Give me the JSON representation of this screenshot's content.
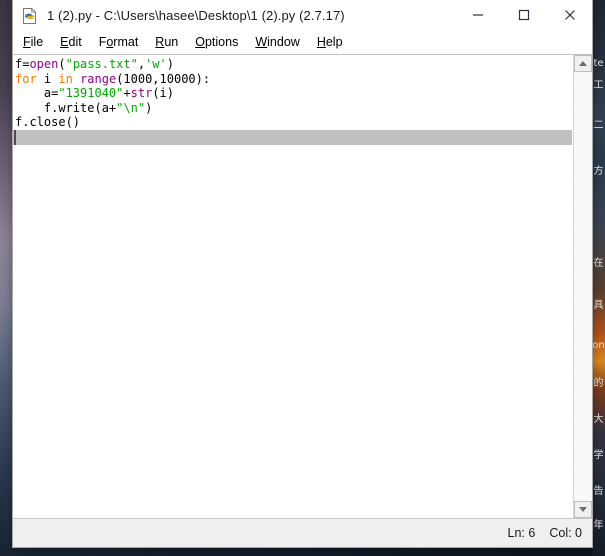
{
  "window": {
    "title": "1 (2).py - C:\\Users\\hasee\\Desktop\\1 (2).py (2.7.17)",
    "icon": "python-idle-file-icon",
    "controls": {
      "minimize": "—",
      "maximize": "□",
      "close": "✕"
    }
  },
  "menubar": {
    "items": [
      {
        "label": "File",
        "accel_index": 0
      },
      {
        "label": "Edit",
        "accel_index": 0
      },
      {
        "label": "Format",
        "accel_index": 1
      },
      {
        "label": "Run",
        "accel_index": 0
      },
      {
        "label": "Options",
        "accel_index": 0
      },
      {
        "label": "Window",
        "accel_index": 0
      },
      {
        "label": "Help",
        "accel_index": 0
      }
    ]
  },
  "editor": {
    "lines": [
      {
        "n": 1,
        "tokens": [
          {
            "t": "f=",
            "c": "plain"
          },
          {
            "t": "open",
            "c": "builtin"
          },
          {
            "t": "(",
            "c": "plain"
          },
          {
            "t": "\"pass.txt\"",
            "c": "string"
          },
          {
            "t": ",",
            "c": "plain"
          },
          {
            "t": "'w'",
            "c": "string"
          },
          {
            "t": ")",
            "c": "plain"
          }
        ]
      },
      {
        "n": 2,
        "tokens": [
          {
            "t": "for",
            "c": "keyword"
          },
          {
            "t": " i ",
            "c": "plain"
          },
          {
            "t": "in",
            "c": "keyword"
          },
          {
            "t": " ",
            "c": "plain"
          },
          {
            "t": "range",
            "c": "builtin"
          },
          {
            "t": "(1000,10000):",
            "c": "plain"
          }
        ]
      },
      {
        "n": 3,
        "tokens": [
          {
            "t": "    a=",
            "c": "plain"
          },
          {
            "t": "\"1391040\"",
            "c": "string"
          },
          {
            "t": "+",
            "c": "plain"
          },
          {
            "t": "str",
            "c": "builtin"
          },
          {
            "t": "(i)",
            "c": "plain"
          }
        ]
      },
      {
        "n": 4,
        "tokens": [
          {
            "t": "    f.write(a+",
            "c": "plain"
          },
          {
            "t": "\"\\n\"",
            "c": "string"
          },
          {
            "t": ")",
            "c": "plain"
          }
        ]
      },
      {
        "n": 5,
        "tokens": [
          {
            "t": "f.close()",
            "c": "plain"
          }
        ]
      },
      {
        "n": 6,
        "tokens": [],
        "selected": true
      }
    ],
    "colors": {
      "keyword": "#ff7700",
      "builtin": "#900090",
      "string": "#00aa00",
      "plain": "#000000",
      "selection": "#c0c0c0",
      "background": "#ffffff"
    }
  },
  "scrollbar": {
    "up_arrow": "scroll-up-arrow",
    "down_arrow": "scroll-down-arrow"
  },
  "statusbar": {
    "line_label": "Ln: 6",
    "col_label": "Col: 0"
  },
  "background_window": {
    "cjk_fragments": [
      "te",
      "工",
      "二",
      "方",
      "\\",
      "在",
      "具",
      "on",
      "的",
      "大",
      "学",
      "告",
      "年",
      "在"
    ]
  }
}
